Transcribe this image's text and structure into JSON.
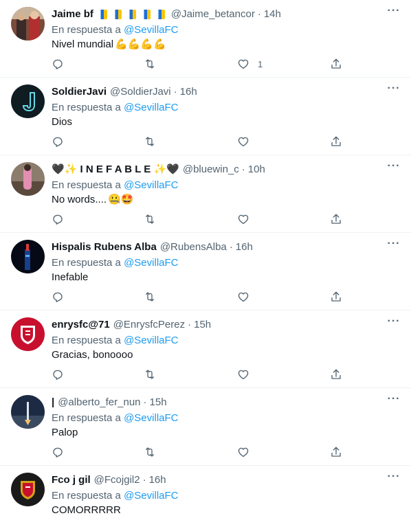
{
  "reply_prefix": "En respuesta a",
  "reply_target": "@SevillaFC",
  "tweets": [
    {
      "name": "Jaime bf",
      "name_extra": "🇮🇨🇮🇨🇮🇨🇮🇨🇮🇨",
      "handle": "@Jaime_betancor",
      "time": "14h",
      "text": "Nivel mundial",
      "emoji": "💪💪💪💪",
      "likes": "1"
    },
    {
      "name": "SoldierJavi",
      "name_extra": "",
      "handle": "@SoldierJavi",
      "time": "16h",
      "text": "Dios",
      "emoji": "",
      "likes": ""
    },
    {
      "name": "🖤✨ I N E F A B L E ✨🖤",
      "name_extra": "",
      "handle": "@bluewin_c",
      "time": "10h",
      "text": "No words....",
      "emoji": "🤐🤩",
      "likes": ""
    },
    {
      "name": "Hispalis Rubens Alba",
      "name_extra": "",
      "handle": "@RubensAlba",
      "time": "16h",
      "text": "Inefable",
      "emoji": "",
      "likes": ""
    },
    {
      "name": "enrysfc@71",
      "name_extra": "",
      "handle": "@EnrysfcPerez",
      "time": "15h",
      "text": "Gracias, bonoooo",
      "emoji": "",
      "likes": ""
    },
    {
      "name": "|",
      "name_extra": "",
      "handle": "@alberto_fer_nun",
      "time": "15h",
      "text": "Palop",
      "emoji": "",
      "likes": ""
    },
    {
      "name": "Fco j gil",
      "name_extra": "",
      "handle": "@Fcojgil2",
      "time": "16h",
      "text": "COMORRRRR",
      "emoji": "",
      "likes": ""
    }
  ],
  "icons": {
    "reply": "reply-icon",
    "retweet": "retweet-icon",
    "like": "heart-icon",
    "share": "share-icon",
    "more": "more-icon"
  },
  "colors": {
    "link": "#1d9bf0",
    "secondary_text": "#536471",
    "primary_text": "#0f1419",
    "divider": "#eff3f4"
  }
}
